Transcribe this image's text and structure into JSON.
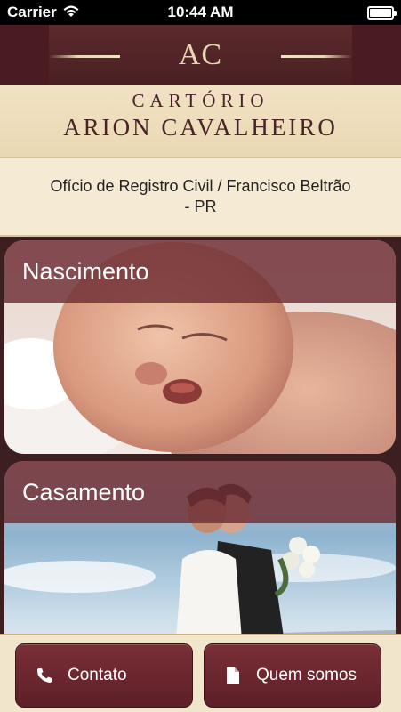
{
  "status_bar": {
    "carrier": "Carrier",
    "time": "10:44 AM",
    "icons": [
      "wifi-icon",
      "battery-icon"
    ]
  },
  "header": {
    "monogram": "AC",
    "name_line1": "CARTÓRIO",
    "name_line2": "ARION CAVALHEIRO"
  },
  "subtitle": "Ofício de Registro Civil / Francisco Beltrão - PR",
  "cards": [
    {
      "title": "Nascimento",
      "image": "sleeping-baby-photo"
    },
    {
      "title": "Casamento",
      "image": "wedding-couple-photo"
    }
  ],
  "bottom_bar": {
    "contact_label": "Contato",
    "contact_icon": "phone-icon",
    "about_label": "Quem somos",
    "about_icon": "document-icon"
  },
  "colors": {
    "burgundy": "#4a1c22",
    "cream": "#f1e2c4",
    "button": "#6b2730"
  }
}
